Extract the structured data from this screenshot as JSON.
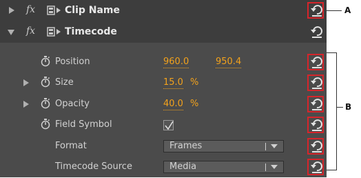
{
  "rows": {
    "clip_name": {
      "fx": "fx",
      "title": "Clip Name"
    },
    "timecode": {
      "fx": "fx",
      "title": "Timecode"
    },
    "position": {
      "label": "Position",
      "x_value": "960.0",
      "y_value": "950.4"
    },
    "size": {
      "label": "Size",
      "value": "15.0",
      "unit": "%"
    },
    "opacity": {
      "label": "Opacity",
      "value": "40.0",
      "unit": "%"
    },
    "field_symbol": {
      "label": "Field Symbol",
      "checked": true
    },
    "format": {
      "label": "Format",
      "selected": "Frames"
    },
    "timecode_source": {
      "label": "Timecode Source",
      "selected": "Media"
    }
  },
  "callouts": {
    "a": "A",
    "b": "B"
  },
  "icons": {
    "reset": "reset-arrow-icon",
    "stopwatch": "stopwatch-icon",
    "effect_badge": "effect-badge-icon",
    "expand": "triangle-icon"
  },
  "colors": {
    "panel_bg": "#4b4b4b",
    "header_bg": "#3d3d3d",
    "value_orange": "#f3a21c",
    "highlight_red": "#d6252b"
  }
}
